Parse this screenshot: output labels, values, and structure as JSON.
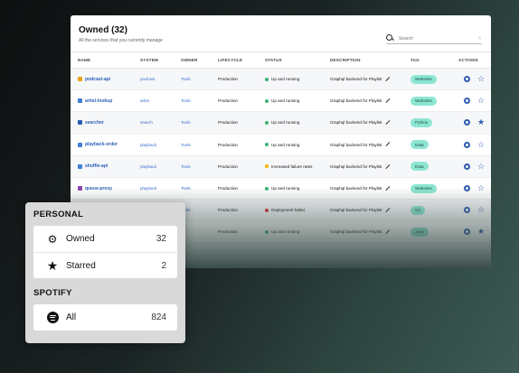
{
  "table": {
    "title": "Owned (32)",
    "subtitle": "All the services that you currently manage",
    "search_placeholder": "Search",
    "columns": [
      "NAME",
      "SYSTEM",
      "OWNER",
      "LIFECYCLE",
      "STATUS",
      "DESCRIPTION",
      "TAG",
      "ACTIONS"
    ],
    "rows": [
      {
        "name": "podcast-api",
        "system": "podcast",
        "owner": "Tools",
        "lifecycle": "Production",
        "status": "Up and running",
        "status_color": "#3cb371",
        "description": "Graphql backend for Playlist",
        "tag": "Websites",
        "icon_color": "#e8a317",
        "starred": false
      },
      {
        "name": "artist-lookup",
        "system": "artist",
        "owner": "Tools",
        "lifecycle": "Production",
        "status": "Up and running",
        "status_color": "#3cb371",
        "description": "Graphql backend for Playlist",
        "tag": "Websites",
        "icon_color": "#3f7fd8",
        "starred": false
      },
      {
        "name": "searcher",
        "system": "search",
        "owner": "Tools",
        "lifecycle": "Production",
        "status": "Up and running",
        "status_color": "#3cb371",
        "description": "Graphql backend for Playlist",
        "tag": "Python",
        "icon_color": "#2d5bb0",
        "starred": true
      },
      {
        "name": "playback-order",
        "system": "playback",
        "owner": "Tools",
        "lifecycle": "Production",
        "status": "Up and running",
        "status_color": "#3cb371",
        "description": "Graphql backend for Playlist",
        "tag": "Data",
        "icon_color": "#3f7fd8",
        "starred": false
      },
      {
        "name": "shuffle-api",
        "system": "playback",
        "owner": "Tools",
        "lifecycle": "Production",
        "status": "Increased failure rates",
        "status_color": "#f0b400",
        "description": "Graphql backend for Playlist",
        "tag": "Data",
        "icon_color": "#3f7fd8",
        "starred": false
      },
      {
        "name": "queue-proxy",
        "system": "playback",
        "owner": "Tools",
        "lifecycle": "Production",
        "status": "Up and running",
        "status_color": "#3cb371",
        "description": "Graphql backend for Playlist",
        "tag": "Websites",
        "icon_color": "#8e44ad",
        "starred": false
      },
      {
        "name": "",
        "system": "",
        "owner": "Tools",
        "lifecycle": "Production",
        "status": "Deployment failed",
        "status_color": "#d9363e",
        "description": "Graphql backend for Playlist",
        "tag": "Go",
        "icon_color": "#888888",
        "starred": false
      },
      {
        "name": "",
        "system": "",
        "owner": "",
        "lifecycle": "Production",
        "status": "Up and running",
        "status_color": "#3cb371",
        "description": "Graphql backend for Playlist",
        "tag": "Java",
        "icon_color": "#888888",
        "starred": true
      }
    ]
  },
  "panel": {
    "personal_heading": "PERSONAL",
    "owned_label": "Owned",
    "owned_count": "32",
    "starred_label": "Starred",
    "starred_count": "2",
    "spotify_heading": "SPOTIFY",
    "all_label": "All",
    "all_count": "824"
  }
}
